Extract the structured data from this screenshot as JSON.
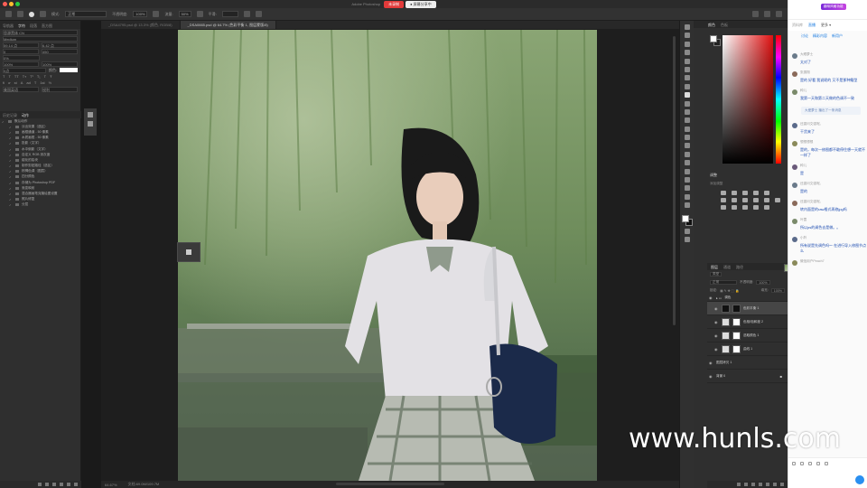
{
  "window": {
    "title": "Adobe Photoshop",
    "recording_badge": "未录制",
    "share_badge": "● 屏幕分享中",
    "traffic_colors": [
      "#ff5f57",
      "#febc2e",
      "#28c840"
    ]
  },
  "options_bar": {
    "mode_label": "模式:",
    "mode_value": "正常",
    "opacity_label": "不透明度:",
    "opacity_value": "100%",
    "flow_label": "流量:",
    "flow_value": "50%",
    "smooth_label": "平滑:"
  },
  "doc_tabs": [
    {
      "label": "_DSA4795.psd @ 13.3% (颜色, RGB/8)",
      "active": false
    },
    {
      "label": "_DSA0665.psd @ 64.7% (色彩平衡 1, 图层蒙版/8)",
      "active": true
    }
  ],
  "left_panel": {
    "tabs": [
      "导航器",
      "字符",
      "段落",
      "直方图"
    ],
    "active_tab": "字符",
    "font_family": "思源黑体 CN",
    "font_style": "Medium",
    "font_size": "59.14 点",
    "leading": "6.42 点",
    "kerning": "0",
    "tracking": "450",
    "scale_v": "0%",
    "scale_h1": "100%",
    "scale_h2": "100%",
    "baseline": "0点",
    "color_label": "颜色:",
    "lang": "美国英语",
    "aa": "锐利"
  },
  "actions_panel": {
    "tabs": [
      "历史记录",
      "动作"
    ],
    "active_tab": "动作",
    "items": [
      "默认动作",
      "淡出效果（选区）",
      "画框通道 - 50 像素",
      "木质画框 - 50 像素",
      "投影（文字）",
      "水中倒影（文字）",
      "自定义 RGB 到灰度",
      "熔化的铅块",
      "制作剪贴路径（选区）",
      "棕褐色调（图层）",
      "四分颜色",
      "存储为 Photoshop PDF",
      "渐变映射",
      "混合器画笔克隆绘图设置",
      "照片修复",
      "分层"
    ]
  },
  "status_bar": {
    "zoom": "64.67%",
    "doc": "文档:69.0M/109.7M"
  },
  "right_panels": {
    "color_tabs": [
      "颜色",
      "色板"
    ],
    "adjustments_title": "调整",
    "adjustments_sub": "添加调整",
    "layers_tabs": [
      "图层",
      "通道",
      "路径"
    ],
    "blend_mode": "正常",
    "opacity_label": "不透明度:",
    "opacity": "100%",
    "lock_label": "锁定:",
    "fill_label": "填充:",
    "fill": "100%",
    "kind_label": "类型",
    "layers": [
      {
        "name": "调色",
        "type": "group"
      },
      {
        "name": "色彩平衡 1",
        "type": "adjust",
        "selected": true
      },
      {
        "name": "色相/饱和度 2",
        "type": "adjust"
      },
      {
        "name": "选取颜色 1",
        "type": "adjust"
      },
      {
        "name": "曲线 1",
        "type": "adjust"
      },
      {
        "name": "图层拷贝 1",
        "type": "photo"
      },
      {
        "name": "背景 0",
        "type": "photo",
        "locked": true
      }
    ]
  },
  "chat": {
    "top_label": "资料库",
    "badge": "趣味风格功能",
    "tabs": [
      "直播",
      "更多 ▾"
    ],
    "sub_tabs": [
      "讨论",
      "精彩内容",
      "新用户"
    ],
    "messages": [
      {
        "name": "大眼萝士",
        "text": "太对了"
      },
      {
        "name": "张振翔",
        "text": "是的 好看 我说呢的 又不是那种鳍型"
      },
      {
        "name": "种儿",
        "text": "我第一天和第二天做的色调不一致"
      },
      {
        "name": "还香问文强呢。",
        "text": "干货来了"
      },
      {
        "name": "想想想想",
        "text": "是的，每次一修图都不敢停住想一天就不一样了"
      },
      {
        "name": "种儿",
        "text": "是"
      },
      {
        "name": "还香问文强呢。",
        "text": "是的"
      },
      {
        "name": "还香问文强呢。",
        "text": "转内面是的raw格式再修jpg吗"
      },
      {
        "name": "叶霞",
        "text": "所以ps的调色去是做。。"
      },
      {
        "name": "小羚",
        "text": "所有说是先调色吗～ 在进行导入修图节点么"
      },
      {
        "name": "微信用户Peach7",
        "text": ""
      }
    ],
    "system_bubble": "大爱萝士 播出了一条消息"
  },
  "watermark": "www.hunls.com",
  "colors": {
    "accent_blue": "#1a7be0",
    "rec_red": "#e23a3a",
    "ps_dark": "#2f2f2f"
  }
}
